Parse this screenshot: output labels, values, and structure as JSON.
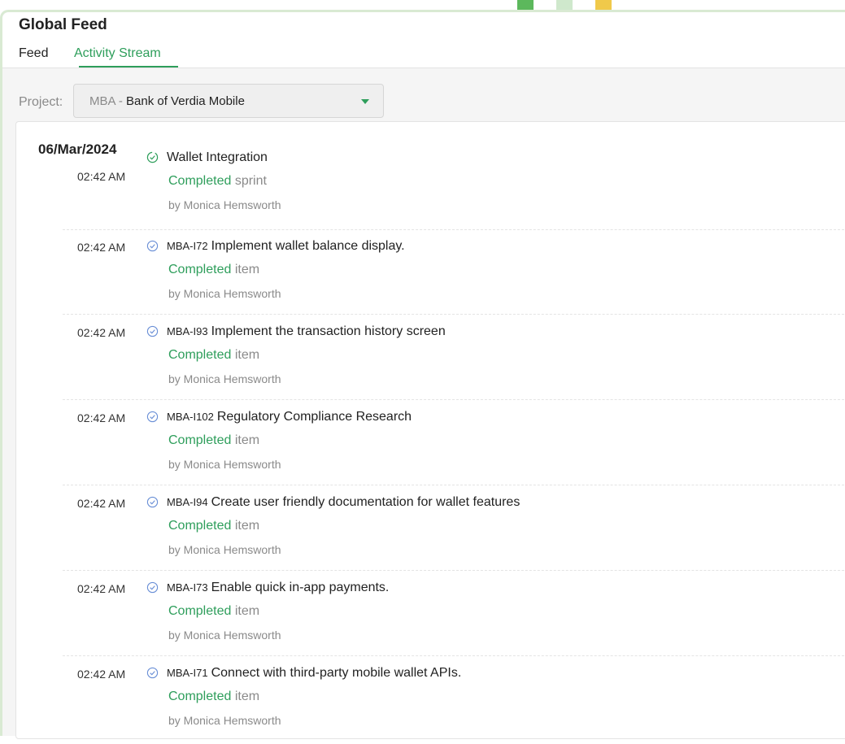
{
  "app": {
    "title": "Global Feed",
    "tabs": [
      {
        "label": "Feed"
      },
      {
        "label": "Activity Stream",
        "active": true
      }
    ],
    "accent_color": "#2e9e5b"
  },
  "filter": {
    "label": "Project:",
    "project_code": "MBA - ",
    "project_name": "Bank of Verdia Mobile"
  },
  "feed": {
    "date": "06/Mar/2024",
    "entries": [
      {
        "time": "02:42 AM",
        "icon": "sprint-check-icon",
        "code": "",
        "title": "Wallet Integration",
        "status": "Completed",
        "type": "sprint",
        "author": "by Monica Hemsworth"
      },
      {
        "time": "02:42 AM",
        "icon": "item-check-icon",
        "code": "MBA-I72",
        "title": "Implement wallet balance display.",
        "status": "Completed",
        "type": "item",
        "author": "by Monica Hemsworth"
      },
      {
        "time": "02:42 AM",
        "icon": "item-check-icon",
        "code": "MBA-I93",
        "title": "Implement the transaction history screen",
        "status": "Completed",
        "type": "item",
        "author": "by Monica Hemsworth"
      },
      {
        "time": "02:42 AM",
        "icon": "item-check-icon",
        "code": "MBA-I102",
        "title": "Regulatory Compliance Research",
        "status": "Completed",
        "type": "item",
        "author": "by Monica Hemsworth"
      },
      {
        "time": "02:42 AM",
        "icon": "item-check-icon",
        "code": "MBA-I94",
        "title": "Create user friendly documentation for wallet features",
        "status": "Completed",
        "type": "item",
        "author": "by Monica Hemsworth"
      },
      {
        "time": "02:42 AM",
        "icon": "item-check-icon",
        "code": "MBA-I73",
        "title": "Enable quick in-app payments.",
        "status": "Completed",
        "type": "item",
        "author": "by Monica Hemsworth"
      },
      {
        "time": "02:42 AM",
        "icon": "item-check-icon",
        "code": "MBA-I71",
        "title": "Connect with third-party mobile wallet APIs.",
        "status": "Completed",
        "type": "item",
        "author": "by Monica Hemsworth"
      }
    ]
  }
}
